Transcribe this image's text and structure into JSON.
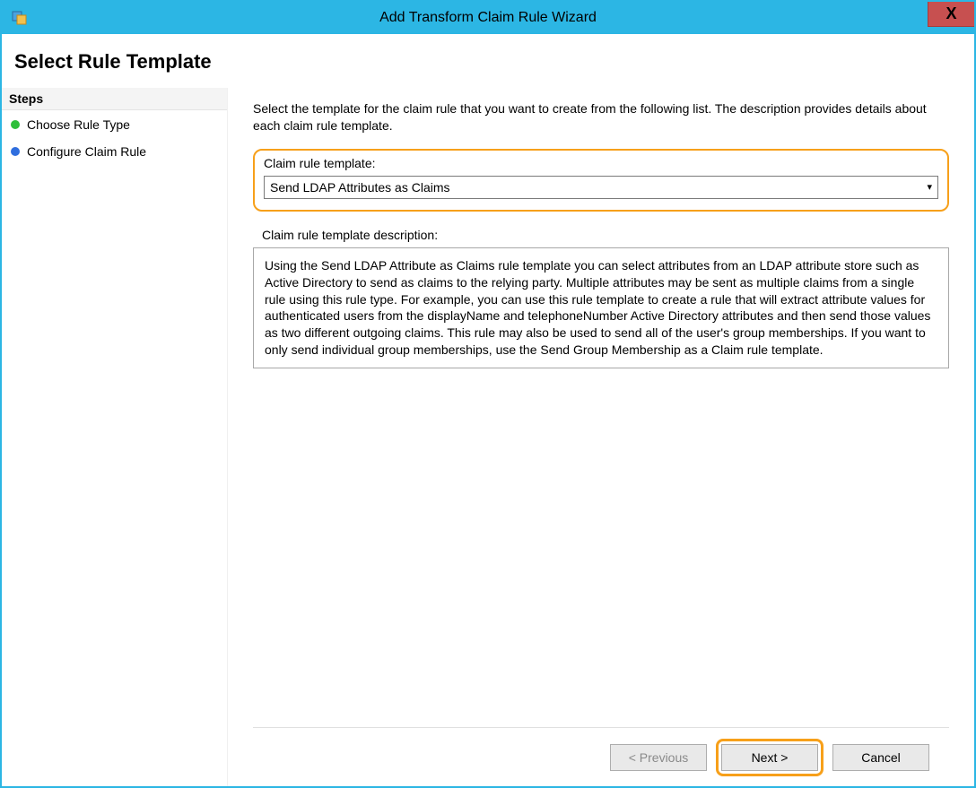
{
  "titlebar": {
    "title": "Add Transform Claim Rule Wizard",
    "close_label": "X"
  },
  "heading": "Select Rule Template",
  "sidebar": {
    "steps_header": "Steps",
    "items": [
      {
        "label": "Choose Rule Type",
        "bullet": "green"
      },
      {
        "label": "Configure Claim Rule",
        "bullet": "blue"
      }
    ]
  },
  "main": {
    "intro": "Select the template for the claim rule that you want to create from the following list. The description provides details about each claim rule template.",
    "template_label": "Claim rule template:",
    "template_selected": "Send LDAP Attributes as Claims",
    "desc_label": "Claim rule template description:",
    "desc_text": "Using the Send LDAP Attribute as Claims rule template you can select attributes from an LDAP attribute store such as Active Directory to send as claims to the relying party. Multiple attributes may be sent as multiple claims from a single rule using this rule type. For example, you can use this rule template to create a rule that will extract attribute values for authenticated users from the displayName and telephoneNumber Active Directory attributes and then send those values as two different outgoing claims. This rule may also be used to send all of the user's group memberships. If you want to only send individual group memberships, use the Send Group Membership as a Claim rule template."
  },
  "buttons": {
    "previous": "< Previous",
    "next": "Next >",
    "cancel": "Cancel"
  }
}
